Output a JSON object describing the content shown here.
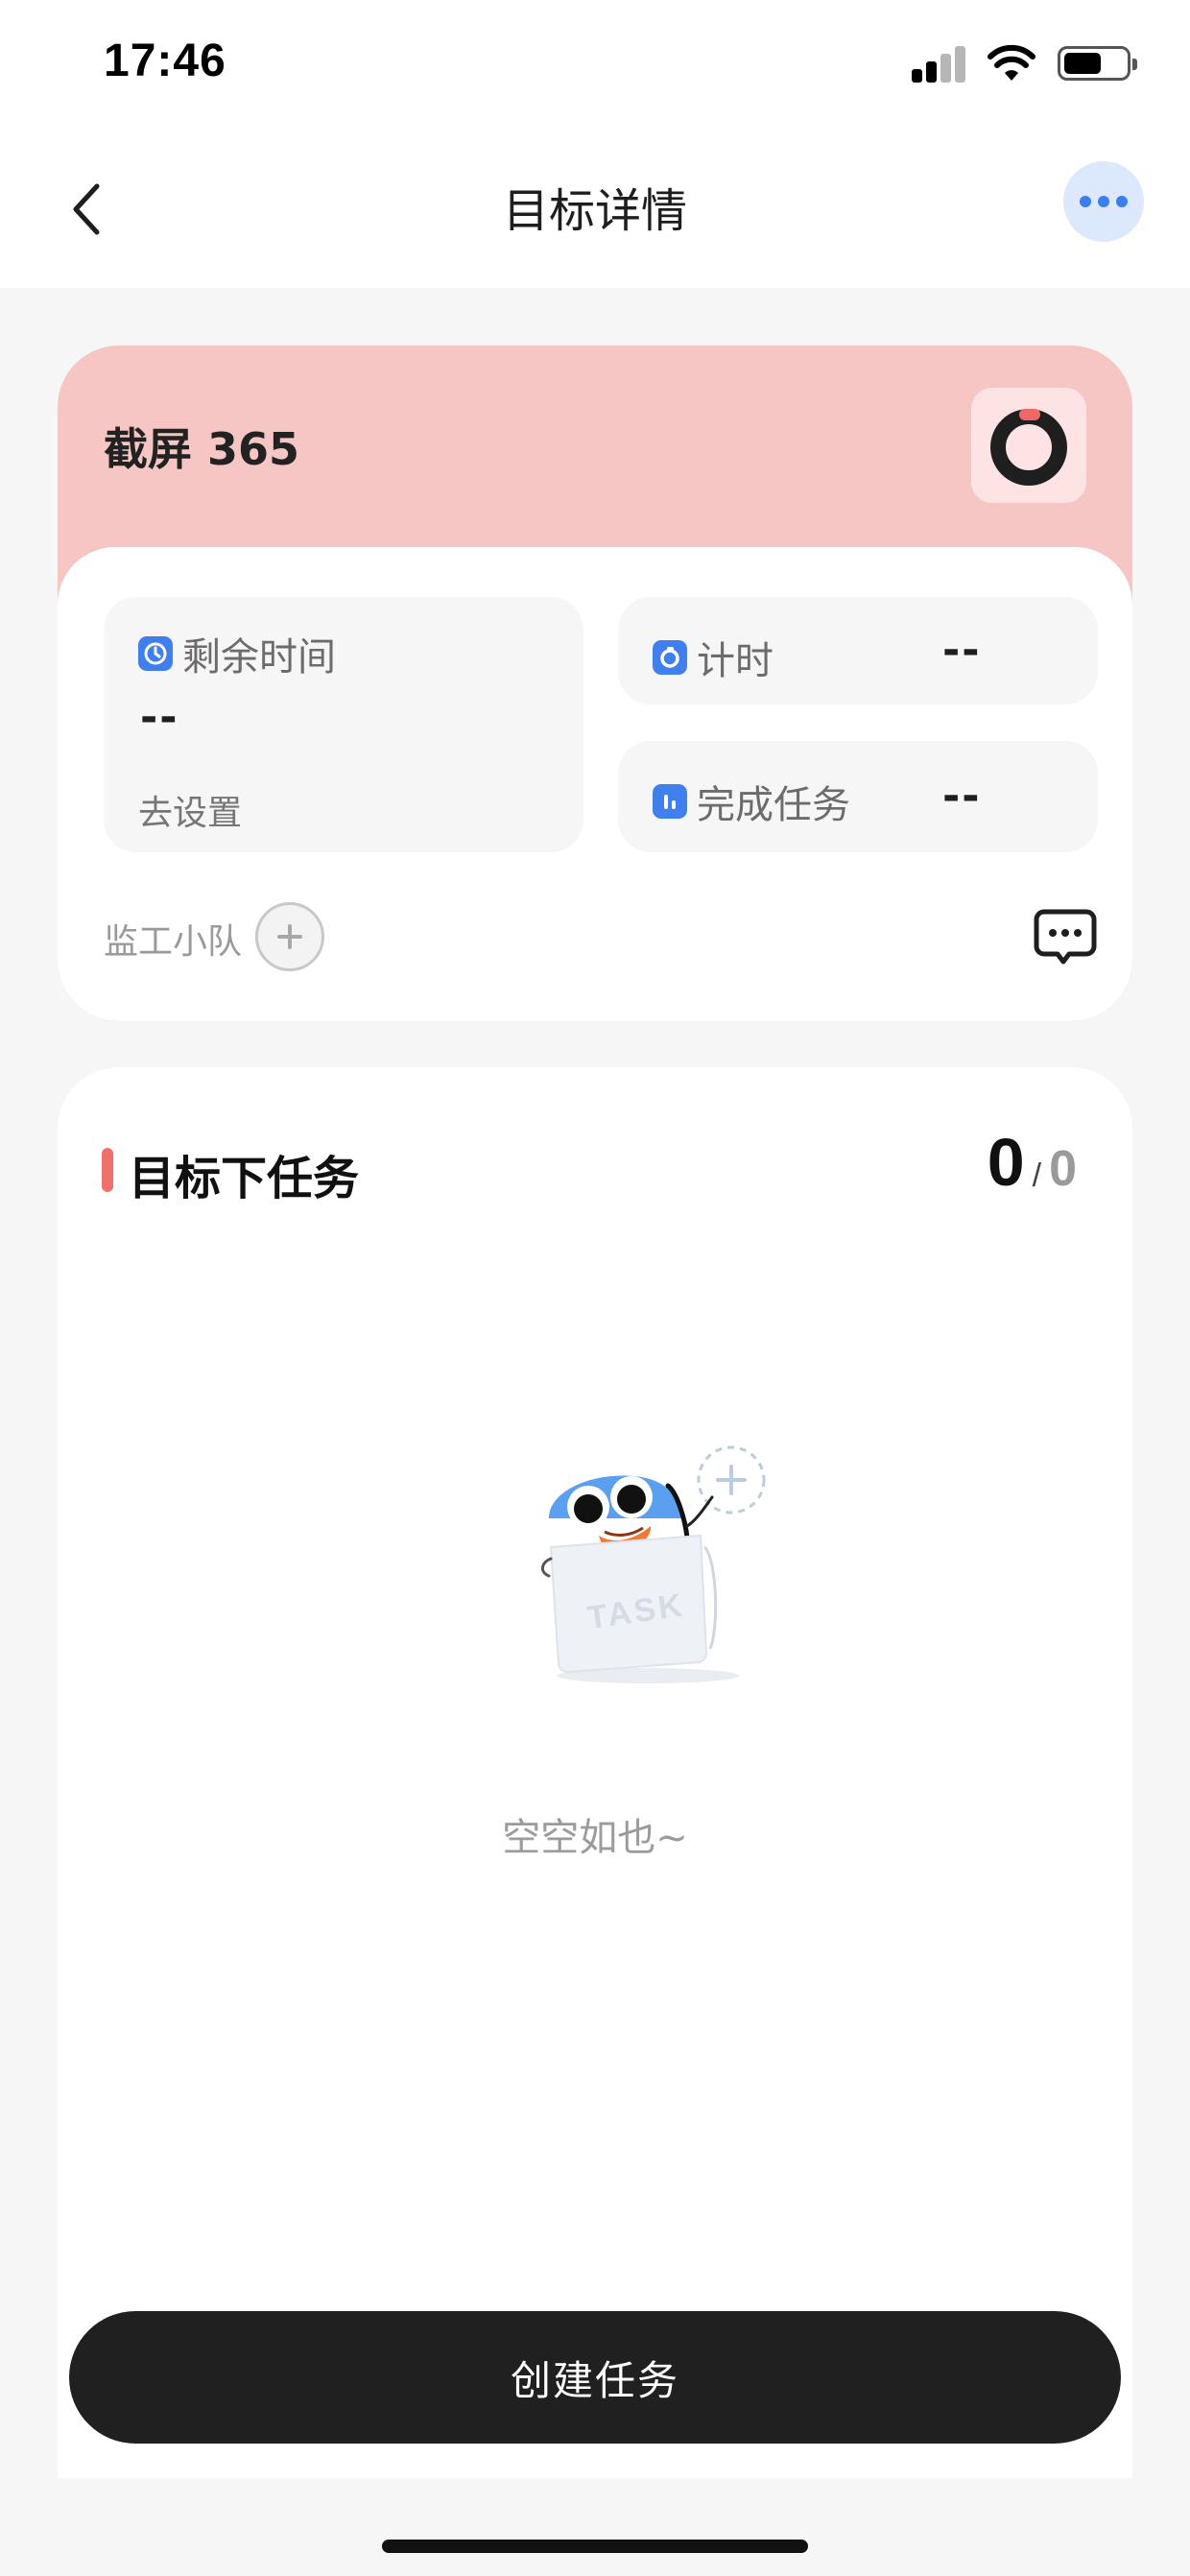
{
  "status_bar": {
    "time": "17:46"
  },
  "nav": {
    "title": "目标详情"
  },
  "goal": {
    "name": "截屏 365",
    "remaining": {
      "label": "剩余时间",
      "value": "--",
      "action": "去设置"
    },
    "timer": {
      "label": "计时",
      "value": "--"
    },
    "completed": {
      "label": "完成任务",
      "value": "--"
    },
    "team_label": "监工小队"
  },
  "tasks": {
    "title": "目标下任务",
    "done_count": "0",
    "separator": "/",
    "total_count": "0",
    "empty_text": "空空如也~",
    "illustration_text": "TASK"
  },
  "actions": {
    "create_task": "创建任务"
  },
  "colors": {
    "accent_blue": "#3f80ee",
    "goal_header": "#f6c6c5",
    "section_marker": "#ef6f6c",
    "primary_button": "#202020"
  }
}
